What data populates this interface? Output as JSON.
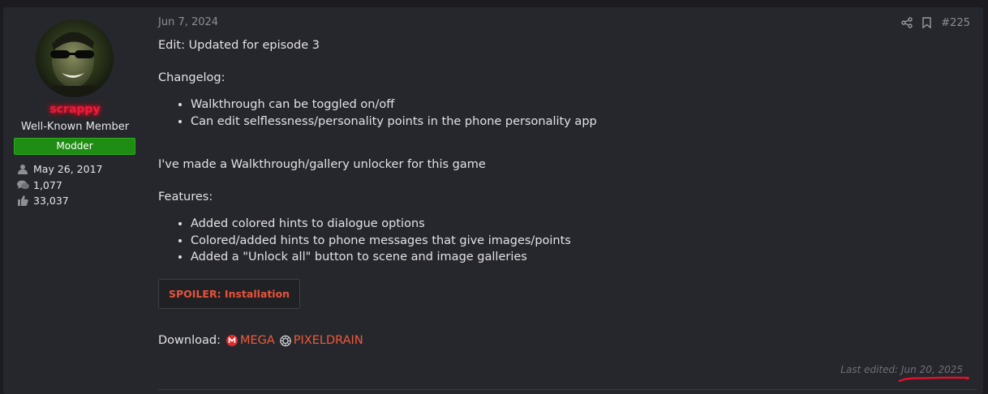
{
  "user": {
    "username": "scrappy",
    "title": "Well-Known Member",
    "banner": "Modder",
    "stats": [
      {
        "icon": "user-icon",
        "value": "May 26, 2017"
      },
      {
        "icon": "comments-icon",
        "value": "1,077"
      },
      {
        "icon": "thumbs-up-icon",
        "value": "33,037"
      }
    ]
  },
  "post": {
    "date": "Jun 7, 2024",
    "number": "#225",
    "edit_line": "Edit: Updated for episode 3",
    "changelog_heading": "Changelog:",
    "changelog": [
      "Walkthrough can be toggled on/off",
      "Can edit selflessness/personality points in the phone personality app"
    ],
    "intro": "I've made a Walkthrough/gallery unlocker for this game",
    "features_heading": "Features:",
    "features": [
      "Added colored hints to dialogue options",
      "Colored/added hints to phone messages that give images/points",
      "Added a \"Unlock all\" button to scene and image galleries"
    ],
    "spoiler_label": "SPOILER: Installation",
    "download_label": "Download:",
    "download_links": [
      "MEGA",
      "PIXELDRAIN"
    ],
    "last_edited": "Last edited: Jun 20, 2025"
  },
  "colors": {
    "username": "#e0233a",
    "banner_bg": "#1f8c13",
    "link": "#f05a3a",
    "annotation": "#e8102a"
  }
}
